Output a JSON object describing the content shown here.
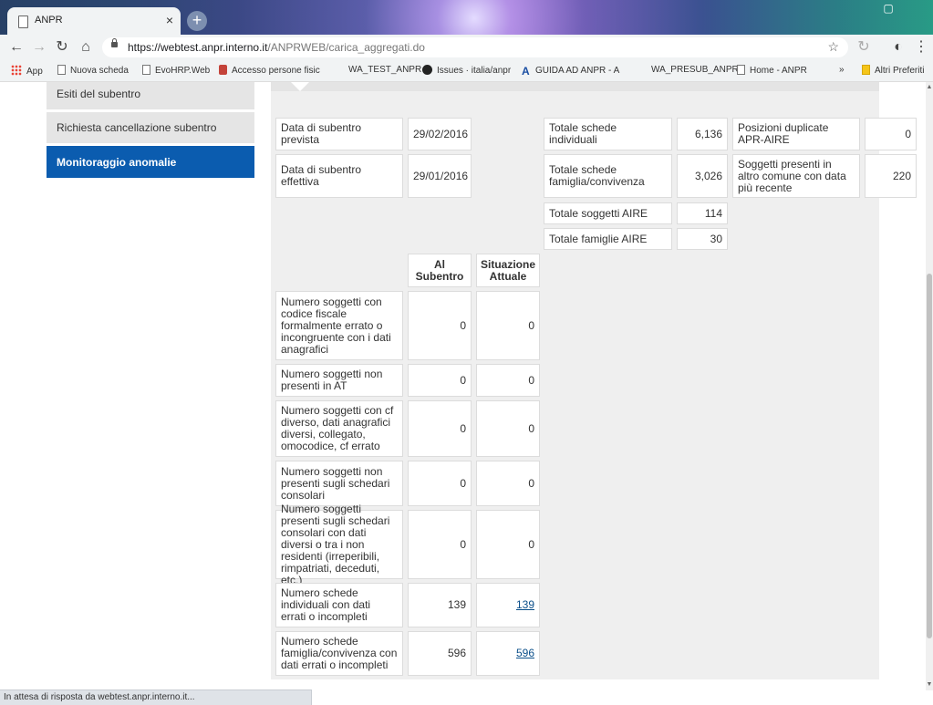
{
  "browser": {
    "tab_title": "ANPR",
    "tab_close": "×",
    "new_tab": "+",
    "url_host": "https://webtest.anpr.interno.it",
    "url_path": "/ANPRWEB/carica_aggregati.do",
    "bookmarks": [
      {
        "label": "App",
        "icon": "apps-grid-icon"
      },
      {
        "label": "Nuova scheda",
        "icon": "page-icon"
      },
      {
        "label": "EvoHRP.Web",
        "icon": "page-icon"
      },
      {
        "label": "Accesso persone fisic",
        "icon": "red-badge-icon"
      },
      {
        "label": "WA_TEST_ANPR",
        "icon": ""
      },
      {
        "label": "Issues · italia/anpr",
        "icon": "github-icon"
      },
      {
        "label": "GUIDA AD ANPR - A",
        "icon": "a-logo-icon"
      },
      {
        "label": "WA_PRESUB_ANPR",
        "icon": ""
      },
      {
        "label": "Home - ANPR",
        "icon": "page-icon"
      },
      {
        "label": "»",
        "icon": ""
      },
      {
        "label": "Altri Preferiti",
        "icon": "folder-icon"
      }
    ],
    "status_text": "In attesa di risposta da webtest.anpr.interno.it..."
  },
  "sidebar": {
    "items": [
      {
        "label": "Esiti del subentro",
        "active": false
      },
      {
        "label": "Richiesta cancellazione subentro",
        "active": false
      },
      {
        "label": "Monitoraggio anomalie",
        "active": true
      }
    ]
  },
  "dates": {
    "prevista_label": "Data di subentro prevista",
    "prevista_value": "29/02/2016",
    "effettiva_label": "Data di subentro effettiva",
    "effettiva_value": "29/01/2016"
  },
  "totals": {
    "schede_individuali_label": "Totale schede individuali",
    "schede_individuali_value": "6,136",
    "schede_famiglia_label": "Totale schede famiglia/convivenza",
    "schede_famiglia_value": "3,026",
    "soggetti_aire_label": "Totale soggetti AIRE",
    "soggetti_aire_value": "114",
    "famiglie_aire_label": "Totale famiglie AIRE",
    "famiglie_aire_value": "30",
    "duplicate_label": "Posizioni duplicate APR-AIRE",
    "duplicate_value": "0",
    "altro_comune_label": "Soggetti presenti in altro comune con data più recente",
    "altro_comune_value": "220"
  },
  "anomalies": {
    "col_subentro": "Al Subentro",
    "col_attuale": "Situazione Attuale",
    "rows": [
      {
        "label": "Numero soggetti con codice fiscale formalmente errato o incongruente con i dati anagrafici",
        "subentro": "0",
        "attuale": "0"
      },
      {
        "label": "Numero soggetti non presenti in AT",
        "subentro": "0",
        "attuale": "0"
      },
      {
        "label": "Numero soggetti con cf diverso, dati anagrafici diversi, collegato, omocodice, cf errato",
        "subentro": "0",
        "attuale": "0"
      },
      {
        "label": "Numero soggetti non presenti sugli schedari consolari",
        "subentro": "0",
        "attuale": "0"
      },
      {
        "label": "Numero soggetti presenti sugli schedari consolari con dati diversi o tra i non residenti (irreperibili, rimpatriati, deceduti, etc.)",
        "subentro": "0",
        "attuale": "0"
      },
      {
        "label": "Numero schede individuali con dati errati o incompleti",
        "subentro": "139",
        "attuale": "139"
      },
      {
        "label": "Numero schede famiglia/convivenza con dati errati o incompleti",
        "subentro": "596",
        "attuale": "596"
      }
    ]
  },
  "colors": {
    "active_nav": "#0b5caf",
    "panel_bg": "#efefef",
    "link": "#0b4f8a"
  }
}
